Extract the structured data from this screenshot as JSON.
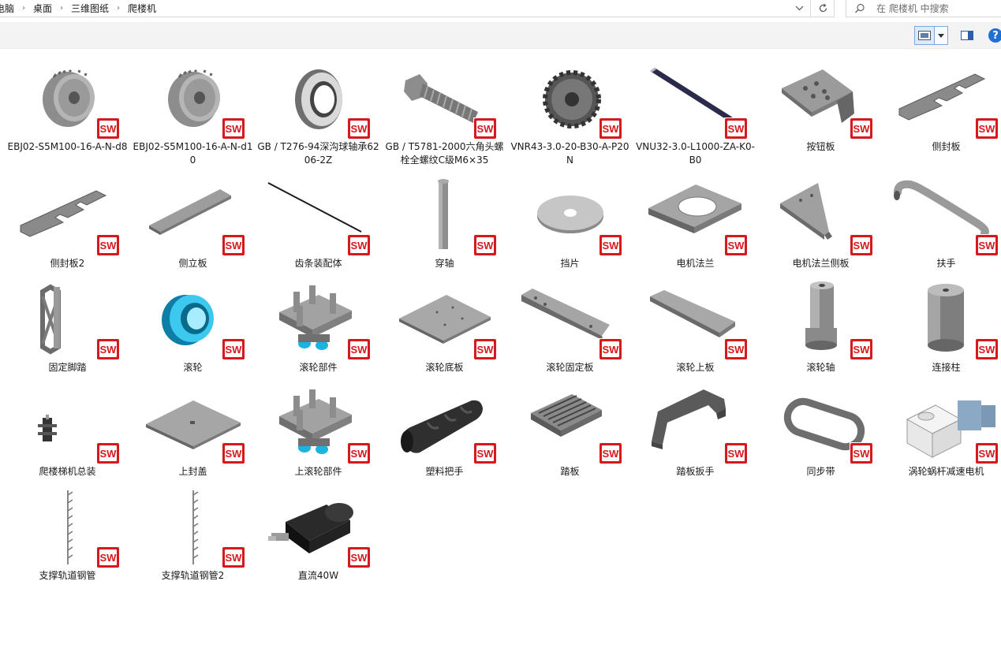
{
  "address": {
    "breadcrumbs": [
      "电脑",
      "桌面",
      "三维图纸",
      "爬楼机"
    ]
  },
  "search": {
    "placeholder": "在 爬楼机 中搜索"
  },
  "icons": {
    "breadcrumb_sep": "chevron-right-icon",
    "address_dropdown": "chevron-down-icon",
    "refresh": "refresh-icon",
    "search": "search-icon",
    "view": "large-icons-view-icon",
    "view_dropdown": "triangle-down-icon",
    "preview_pane": "preview-pane-icon",
    "help": "help-icon",
    "file_badge": "solidworks-badge-icon"
  },
  "help_label": "?",
  "colors": {
    "badge_red": "#d6191c",
    "selected_view": "#dbe9f8",
    "help_blue": "#1f6fd6",
    "toolbar_bg": "#f3f3f3"
  },
  "badge_text": "SW",
  "files": [
    {
      "name": "EBJ02-S5M100-16-A-N-d8",
      "thumb": "pulley"
    },
    {
      "name": "EBJ02-S5M100-16-A-N-d10",
      "thumb": "pulley"
    },
    {
      "name": "GB / T276-94深沟球轴承6206-2Z",
      "thumb": "bearing"
    },
    {
      "name": "GB / T5781-2000六角头螺栓全螺纹C级M6×35",
      "thumb": "bolt"
    },
    {
      "name": "VNR43-3.0-20-B30-A-P20N",
      "thumb": "gear"
    },
    {
      "name": "VNU32-3.0-L1000-ZA-K0-B0",
      "thumb": "rack"
    },
    {
      "name": "按钮板",
      "thumb": "button-plate"
    },
    {
      "name": "侧封板",
      "thumb": "side-plate"
    },
    {
      "name": "侧封板2",
      "thumb": "side-plate"
    },
    {
      "name": "侧立板",
      "thumb": "long-plate"
    },
    {
      "name": "齿条装配体",
      "thumb": "rack-thin"
    },
    {
      "name": "穿轴",
      "thumb": "shaft"
    },
    {
      "name": "挡片",
      "thumb": "washer"
    },
    {
      "name": "电机法兰",
      "thumb": "flange"
    },
    {
      "name": "电机法兰侧板",
      "thumb": "flange-side"
    },
    {
      "name": "扶手",
      "thumb": "handle-pipe"
    },
    {
      "name": "固定脚踏",
      "thumb": "pedal-frame"
    },
    {
      "name": "滚轮",
      "thumb": "roller"
    },
    {
      "name": "滚轮部件",
      "thumb": "roller-assy"
    },
    {
      "name": "滚轮底板",
      "thumb": "square-plate"
    },
    {
      "name": "滚轮固定板",
      "thumb": "bar-plate"
    },
    {
      "name": "滚轮上板",
      "thumb": "bar-plate2"
    },
    {
      "name": "滚轮轴",
      "thumb": "roller-shaft"
    },
    {
      "name": "连接柱",
      "thumb": "cylinder"
    },
    {
      "name": "爬楼梯机总装",
      "thumb": "small-assy"
    },
    {
      "name": "上封盖",
      "thumb": "cover"
    },
    {
      "name": "上滚轮部件",
      "thumb": "roller-assy"
    },
    {
      "name": "塑料把手",
      "thumb": "grip"
    },
    {
      "name": "踏板",
      "thumb": "tread"
    },
    {
      "name": "踏板扳手",
      "thumb": "tread-handle"
    },
    {
      "name": "同步带",
      "thumb": "belt"
    },
    {
      "name": "涡轮蜗杆减速电机",
      "thumb": "worm-motor"
    },
    {
      "name": "支撑轨道钢管",
      "thumb": "rail"
    },
    {
      "name": "支撑轨道钢管2",
      "thumb": "rail"
    },
    {
      "name": "直流40W",
      "thumb": "dc-motor"
    }
  ]
}
